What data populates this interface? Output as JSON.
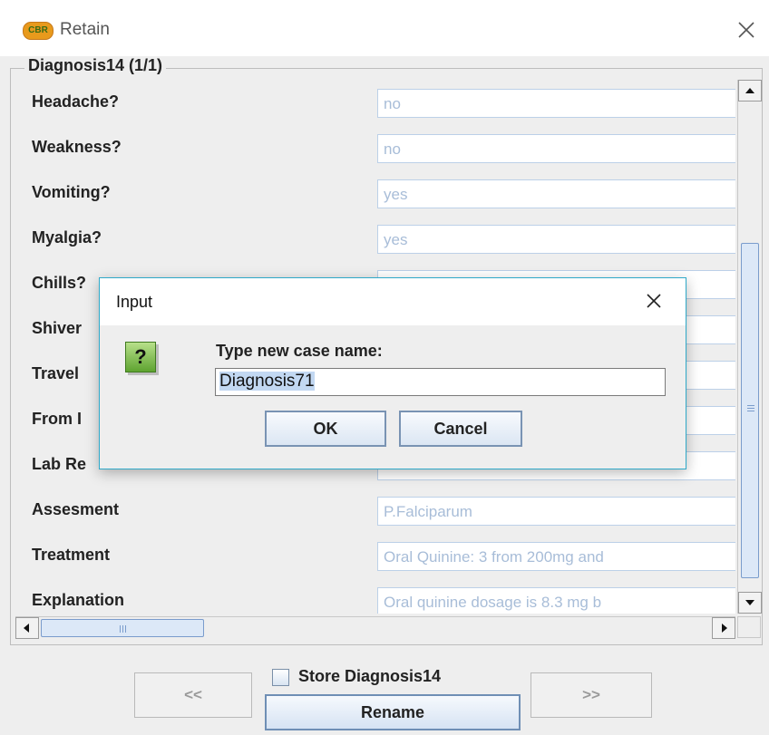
{
  "window": {
    "title": "Retain",
    "app_icon_text": "CBR",
    "close_icon": "close-icon"
  },
  "case_panel": {
    "title": "Diagnosis14 (1/1)",
    "rows": [
      {
        "label": "Headache?",
        "value": "no"
      },
      {
        "label": "Weakness?",
        "value": "no"
      },
      {
        "label": "Vomiting?",
        "value": "yes"
      },
      {
        "label": "Myalgia?",
        "value": "yes"
      },
      {
        "label": "Chills?",
        "value": ""
      },
      {
        "label": "Shiver",
        "value": ""
      },
      {
        "label": "Travel",
        "value": ""
      },
      {
        "label": "From I",
        "value": ""
      },
      {
        "label": "Lab Re",
        "value": ""
      },
      {
        "label": "Assesment",
        "value": "P.Falciparum"
      },
      {
        "label": "Treatment",
        "value": "Oral Quinine: 3 from 200mg and"
      },
      {
        "label": "Explanation",
        "value": "Oral quinine dosage is 8.3 mg b"
      }
    ]
  },
  "footer": {
    "prev_label": "<<",
    "next_label": ">>",
    "store_label": "Store Diagnosis14",
    "store_checked": false,
    "rename_label": "Rename"
  },
  "dialog": {
    "title": "Input",
    "icon": "question-icon",
    "icon_text": "?",
    "prompt": "Type new case name:",
    "input_value": "Diagnosis71",
    "ok_label": "OK",
    "cancel_label": "Cancel"
  }
}
